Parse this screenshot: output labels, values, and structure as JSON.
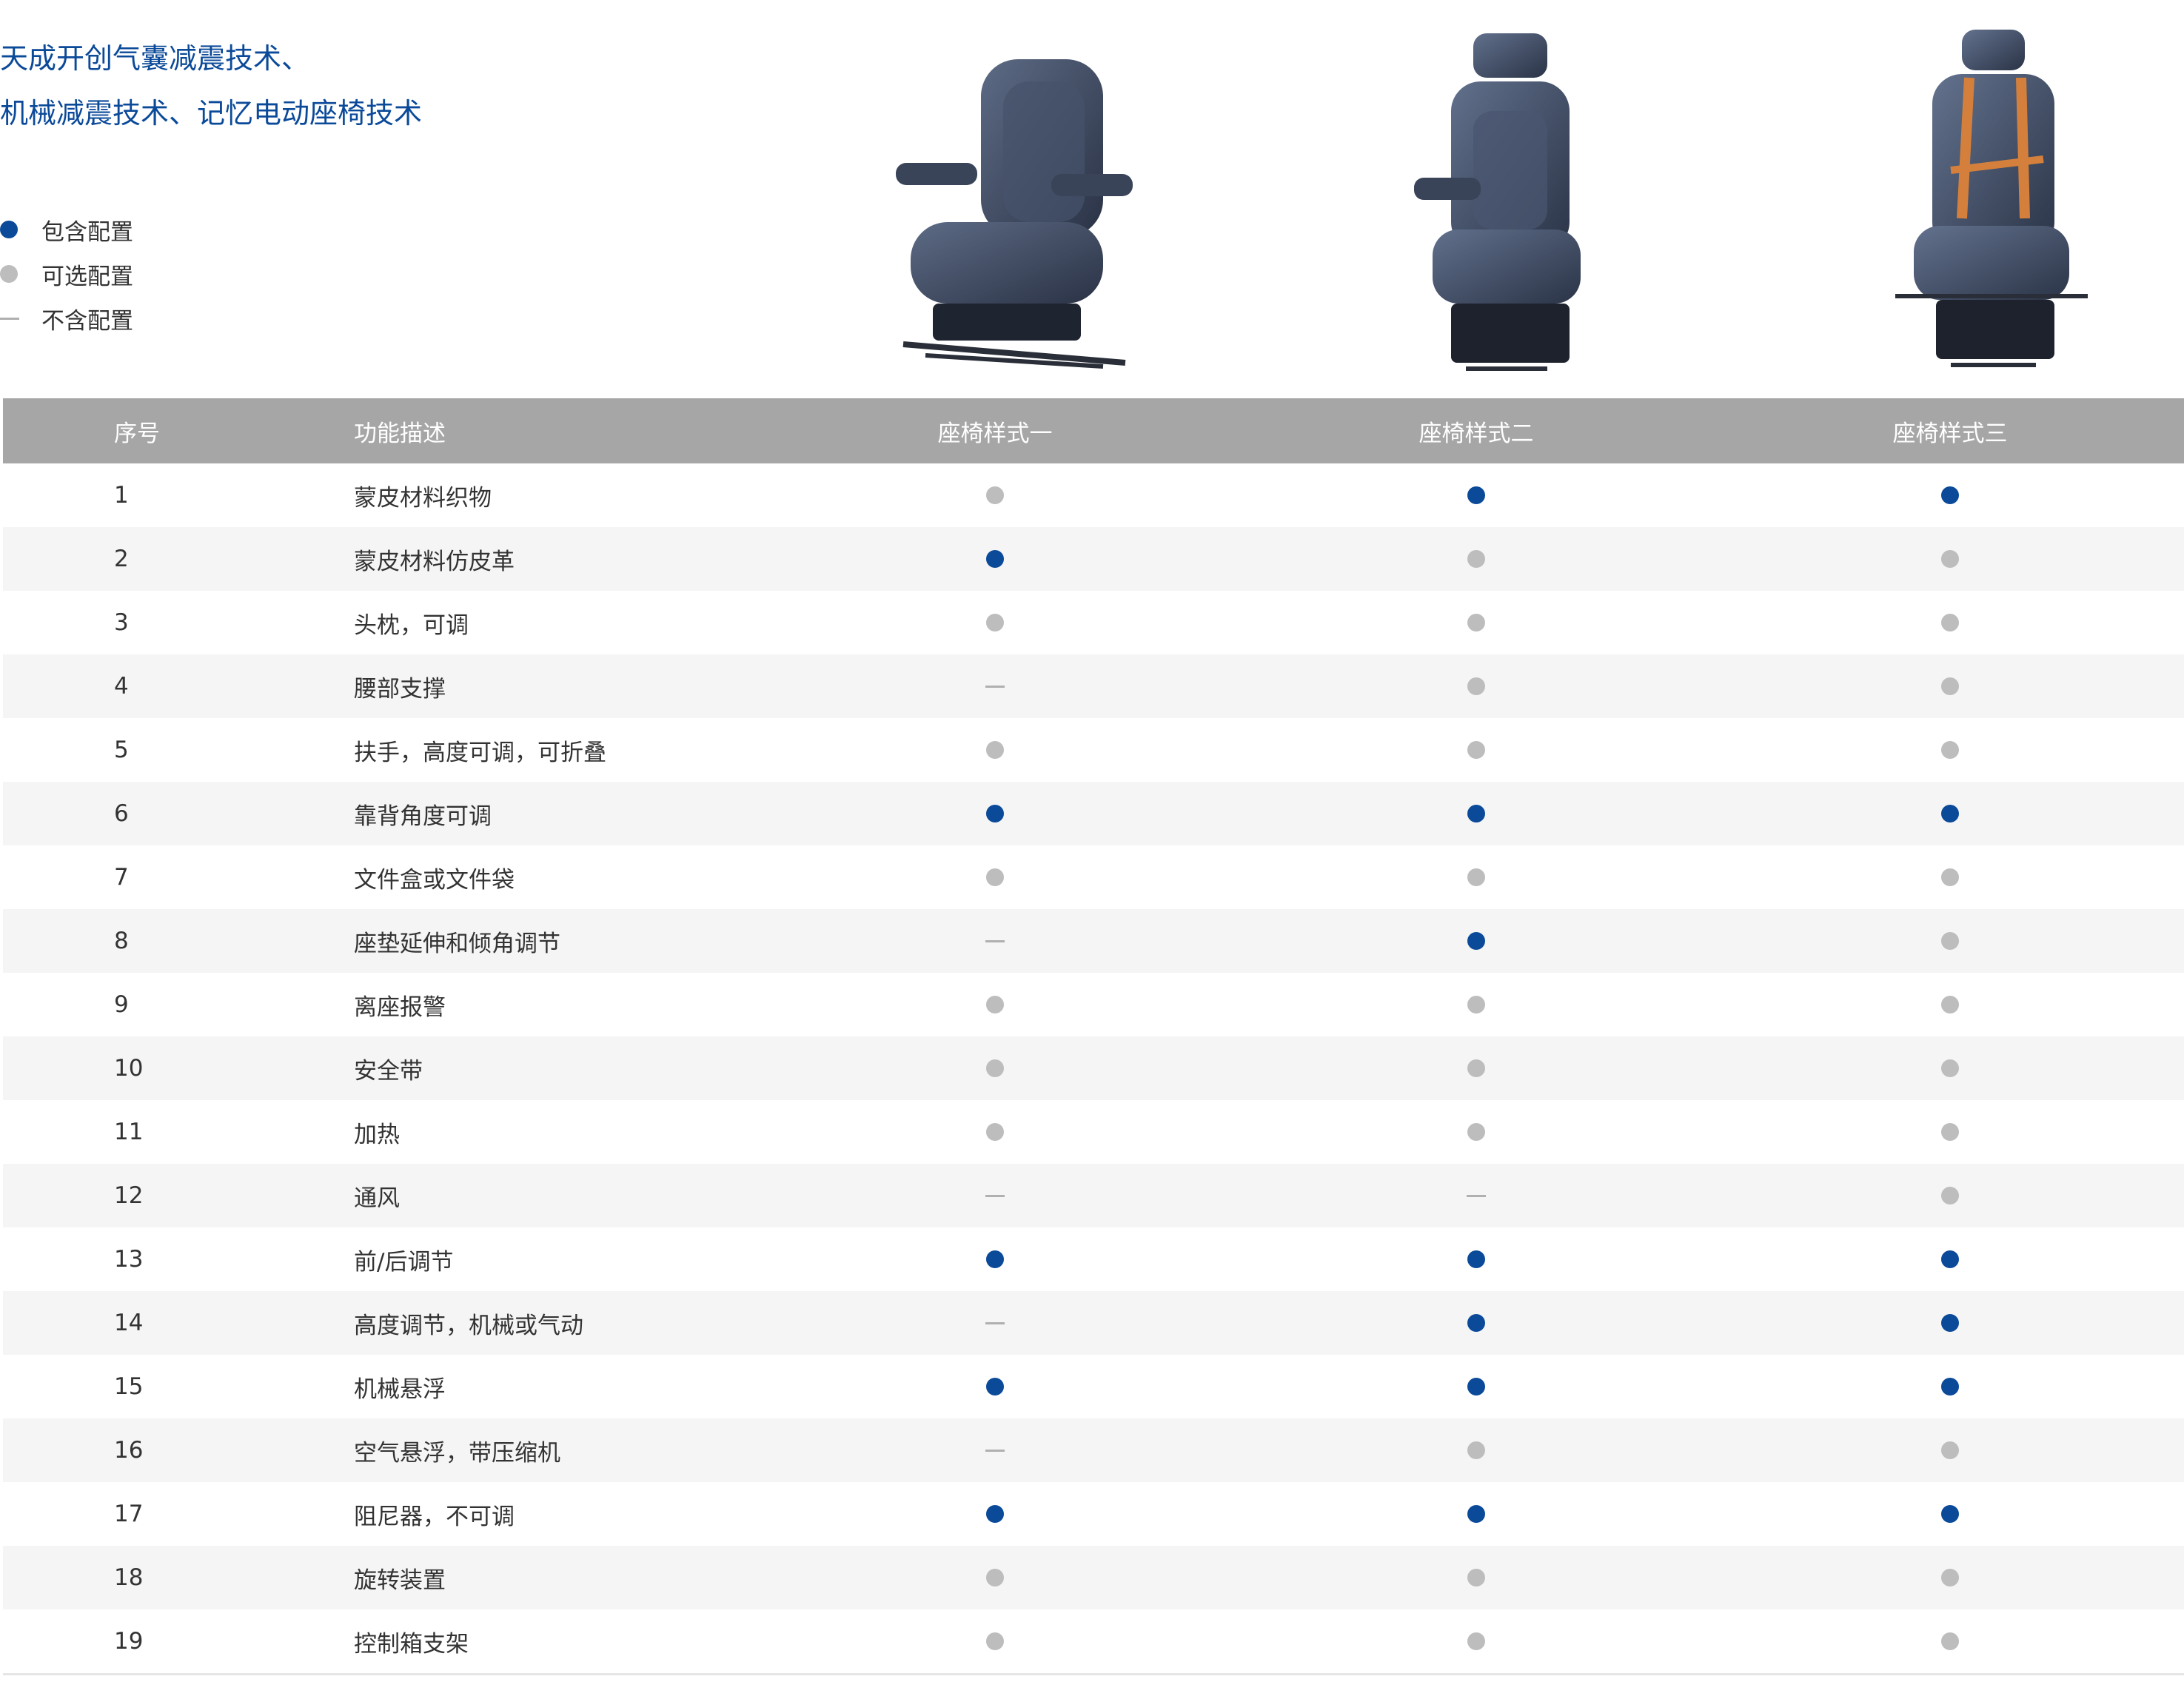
{
  "intro": {
    "line1": "天成开创气囊减震技术、",
    "line2": "机械减震技术、记忆电动座椅技术"
  },
  "legend": [
    {
      "mark": "included",
      "label": "包含配置"
    },
    {
      "mark": "optional",
      "label": "可选配置"
    },
    {
      "mark": "excluded",
      "label": "不含配置"
    }
  ],
  "colors": {
    "accent": "#0b4a99",
    "optional": "#bdbdbd",
    "header_bg": "#a6a6a6",
    "row_alt": "#f5f5f5"
  },
  "table": {
    "headers": {
      "num": "序号",
      "desc": "功能描述",
      "s1": "座椅样式一",
      "s2": "座椅样式二",
      "s3": "座椅样式三"
    },
    "rows": [
      {
        "num": "1",
        "desc": "蒙皮材料织物",
        "s1": "optional",
        "s2": "included",
        "s3": "included"
      },
      {
        "num": "2",
        "desc": "蒙皮材料仿皮革",
        "s1": "included",
        "s2": "optional",
        "s3": "optional"
      },
      {
        "num": "3",
        "desc": "头枕，可调",
        "s1": "optional",
        "s2": "optional",
        "s3": "optional"
      },
      {
        "num": "4",
        "desc": "腰部支撑",
        "s1": "excluded",
        "s2": "optional",
        "s3": "optional"
      },
      {
        "num": "5",
        "desc": "扶手，高度可调，可折叠",
        "s1": "optional",
        "s2": "optional",
        "s3": "optional"
      },
      {
        "num": "6",
        "desc": "靠背角度可调",
        "s1": "included",
        "s2": "included",
        "s3": "included"
      },
      {
        "num": "7",
        "desc": "文件盒或文件袋",
        "s1": "optional",
        "s2": "optional",
        "s3": "optional"
      },
      {
        "num": "8",
        "desc": "座垫延伸和倾角调节",
        "s1": "excluded",
        "s2": "included",
        "s3": "optional"
      },
      {
        "num": "9",
        "desc": "离座报警",
        "s1": "optional",
        "s2": "optional",
        "s3": "optional"
      },
      {
        "num": "10",
        "desc": "安全带",
        "s1": "optional",
        "s2": "optional",
        "s3": "optional"
      },
      {
        "num": "11",
        "desc": "加热",
        "s1": "optional",
        "s2": "optional",
        "s3": "optional"
      },
      {
        "num": "12",
        "desc": "通风",
        "s1": "excluded",
        "s2": "excluded",
        "s3": "optional"
      },
      {
        "num": "13",
        "desc": "前/后调节",
        "s1": "included",
        "s2": "included",
        "s3": "included"
      },
      {
        "num": "14",
        "desc": "高度调节，机械或气动",
        "s1": "excluded",
        "s2": "included",
        "s3": "included"
      },
      {
        "num": "15",
        "desc": "机械悬浮",
        "s1": "included",
        "s2": "included",
        "s3": "included"
      },
      {
        "num": "16",
        "desc": "空气悬浮，带压缩机",
        "s1": "excluded",
        "s2": "optional",
        "s3": "optional"
      },
      {
        "num": "17",
        "desc": "阻尼器，不可调",
        "s1": "included",
        "s2": "included",
        "s3": "included"
      },
      {
        "num": "18",
        "desc": "旋转装置",
        "s1": "optional",
        "s2": "optional",
        "s3": "optional"
      },
      {
        "num": "19",
        "desc": "控制箱支架",
        "s1": "optional",
        "s2": "optional",
        "s3": "optional"
      }
    ]
  }
}
